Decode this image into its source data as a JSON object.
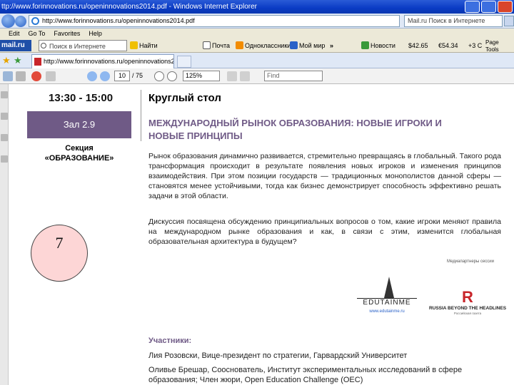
{
  "window": {
    "title": "ttp://www.forinnovations.ru/openinnovations2014.pdf - Windows Internet Explorer"
  },
  "address_bar": {
    "url": "http://www.forinnovations.ru/openinnovations2014.pdf",
    "search_placeholder": "Mail.ru Поиск в Интернете"
  },
  "menu": [
    "Edit",
    "Go To",
    "Favorites",
    "Help"
  ],
  "toolbar": {
    "brand": "mail.ru",
    "search_text": "Поиск в Интернете",
    "items": [
      "Найти",
      "Почта",
      "Одноклассники",
      "Мой мир"
    ],
    "overflow": "»",
    "news": "Новости",
    "usd": "$42.65",
    "eur": "€54.34",
    "temp": "+3 C",
    "page_menu": "Page",
    "tools_menu": "Tools"
  },
  "tab": {
    "title": "http://www.forinnovations.ru/openinnovations2014.pdf"
  },
  "pdf_toolbar": {
    "page": "10",
    "total": "/ 75",
    "zoom": "125%",
    "find": "Find"
  },
  "document": {
    "time": "13:30 - 15:00",
    "hall": "Зал 2.9",
    "section_line1": "Секция",
    "section_line2": "«ОБРАЗОВАНИЕ»",
    "roundtable": "Круглый стол",
    "heading": "МЕЖДУНАРОДНЫЙ РЫНОК ОБРАЗОВАНИЯ: НОВЫЕ ИГРОКИ И НОВЫЕ ПРИНЦИПЫ",
    "paragraph1": "Рынок образования динамично развивается, стремительно превращаясь в глобальный. Такого рода трансформация происходит в результате появления новых игроков и изменения принципов взаимодействия. При этом позиции государств — традиционных монополистов данной сферы — становятся менее устойчивыми, тогда как бизнес демонстрирует способность эффективно решать задачи в этой области.",
    "paragraph2": "Дискуссия посвящена обсуждению принципиальных вопросов о том, какие игроки меняют правила на международном рынке образования и как, в связи с этим, изменится глобальная образовательная архитектура в будущем?",
    "partners_label": "Медиапартнеры сессии",
    "logo1_word": "EDUTAINME",
    "logo1_sub": "www.edutainme.ru",
    "logo2_letter": "R",
    "logo2_text": "RUSSIA BEYOND THE HEADLINES",
    "logo2_sub": "Российская газета",
    "participants_label": "Участники:",
    "person1": "Лия Розовски, Вице-президент по стратегии, Гарвардский Университет",
    "person2": "Оливье Брешар, Сооснователь, Институт экспериментальных исследований в сфере образования; Член жюри, Open Education Challenge (OEC)"
  },
  "page_number": "7",
  "colors": {
    "accent": "#6f5a86",
    "title_bar": "#0a3bc4",
    "page_circle": "#fdd6d6"
  }
}
